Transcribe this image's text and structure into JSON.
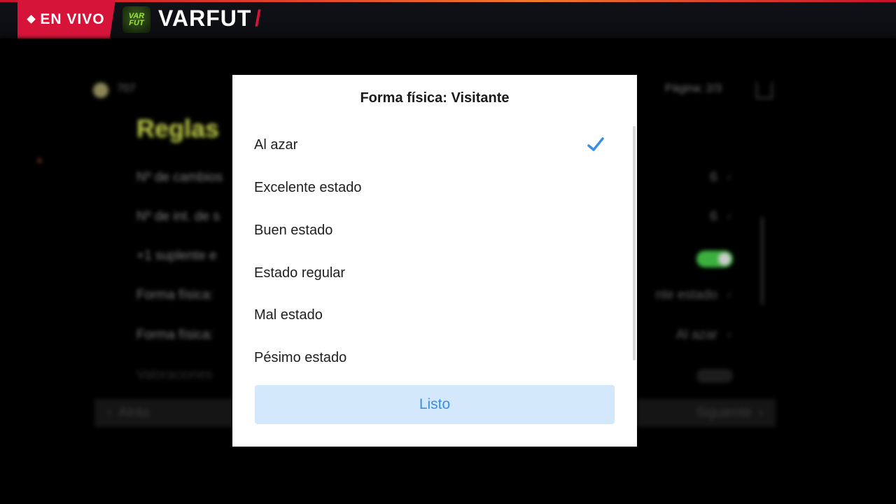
{
  "banner": {
    "live_label": "EN VIVO",
    "logo_text": "VAR FUT",
    "brand_name": "VARFUT",
    "brand_slash": "/",
    "accent_color": "#d6143a"
  },
  "background": {
    "coins": "707",
    "page_indicator": "Página: 2/3",
    "title": "Reglas",
    "rows": [
      {
        "label": "Nº de cambios",
        "value": "6"
      },
      {
        "label": "Nº de int. de s",
        "value": "6"
      },
      {
        "label": "+1 suplente e",
        "value": ""
      },
      {
        "label": "Forma física:",
        "value": "nte estado"
      },
      {
        "label": "Forma física:",
        "value": "Al azar"
      },
      {
        "label": "Valoraciones",
        "value": ""
      }
    ],
    "back_label": "Atrás",
    "next_label": "Siguiente"
  },
  "modal": {
    "title": "Forma física: Visitante",
    "selected_index": 0,
    "options": [
      "Al azar",
      "Excelente estado",
      "Buen estado",
      "Estado regular",
      "Mal estado",
      "Pésimo estado"
    ],
    "done_label": "Listo",
    "check_color": "#3a8ee6"
  }
}
